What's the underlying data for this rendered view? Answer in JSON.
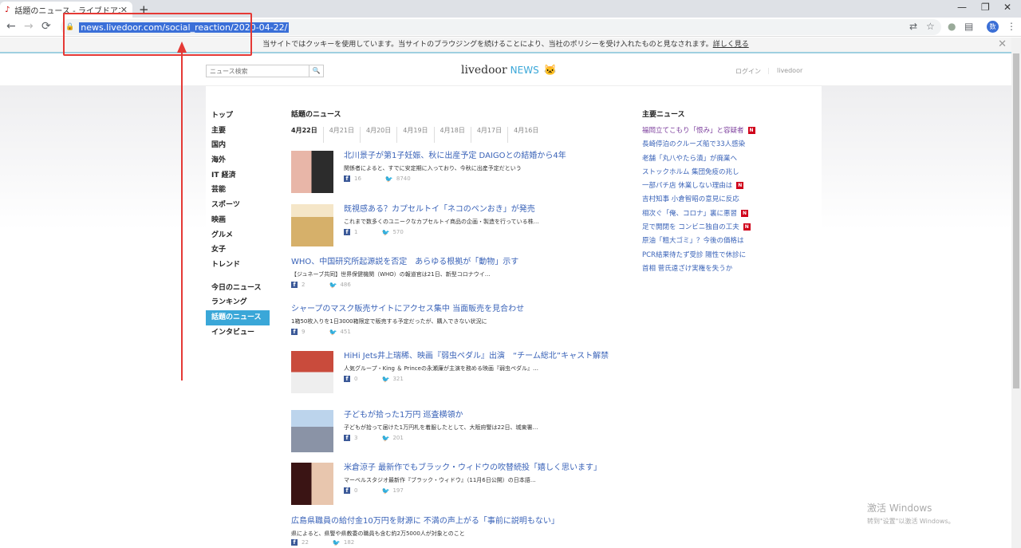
{
  "browser": {
    "tab_title": "話題のニュース - ライブドアニ",
    "tab_favicon": "♪",
    "tab_close": "✕",
    "new_tab": "+",
    "win_minimize": "—",
    "win_restore": "❐",
    "win_close": "✕",
    "back": "←",
    "forward": "→",
    "reload": "⟳",
    "url": "news.livedoor.com/social_reaction/2020-04-22/",
    "profile_initial": "数",
    "menu": "⋮"
  },
  "cookie_bar": {
    "text": "当サイトではクッキーを使用しています。当サイトのブラウジングを続けることにより、当社のポリシーを受け入れたものと見なされます。",
    "link": "詳しく見る",
    "close": "✕"
  },
  "header": {
    "search_placeholder": "ニュース検索",
    "search_btn_icon": "search-icon",
    "logo_main": "livedoor",
    "logo_news": "NEWS",
    "login": "ログイン",
    "divider": "|",
    "livedoor_link": "livedoor"
  },
  "sidebar": {
    "group1": [
      "トップ",
      "主要",
      "国内",
      "海外",
      "IT 経済",
      "芸能",
      "スポーツ",
      "映画",
      "グルメ",
      "女子",
      "トレンド"
    ],
    "group2": [
      "今日のニュース",
      "ランキング",
      "話題のニュース",
      "インタビュー"
    ],
    "active": "話題のニュース"
  },
  "main": {
    "section_title": "話題のニュース",
    "date_tabs": [
      "4月22日",
      "4月21日",
      "4月20日",
      "4月19日",
      "4月18日",
      "4月17日",
      "4月16日"
    ],
    "articles": [
      {
        "title": "北川景子が第1子妊娠、秋に出産予定 DAIGOとの結婚から4年",
        "desc": "関係者によると、すでに安定期に入っており、今秋に出産予定だという",
        "fb": "16",
        "tw": "8740"
      },
      {
        "title": "既視感ある？カプセルトイ「ネコのペンおき」が発売",
        "desc": "これまで数多くのユニークなカプセルトイ商品の企画・製造を行っている株…",
        "fb": "1",
        "tw": "570"
      },
      {
        "title": "WHO、中国研究所起源説を否定　あらゆる根拠が「動物」示す",
        "desc": "【ジュネーブ共同】世界保健機関（WHO）の報道官は21日、新型コロナウイ…",
        "fb": "2",
        "tw": "486"
      },
      {
        "title": "シャープのマスク販売サイトにアクセス集中 当面販売を見合わせ",
        "desc": "1箱50枚入りを1日3000箱限定で販売する予定だったが、購入できない状況に",
        "fb": "9",
        "tw": "451"
      },
      {
        "title": "HiHi Jets井上瑞稀、映画『弱虫ペダル』出演　“チーム総北”キャスト解禁",
        "desc": "人気グループ・King ＆ Princeの永瀬廉が主演を務める映画『弱虫ペダル』…",
        "fb": "0",
        "tw": "321"
      },
      {
        "title": "子どもが拾った1万円 巡査横領か",
        "desc": "子どもが拾って届けた1万円札を着服したとして、大阪府警は22日、城東署…",
        "fb": "3",
        "tw": "201"
      },
      {
        "title": "米倉涼子 最新作でもブラック・ウィドウの吹替続投「嬉しく思います」",
        "desc": "マーベルスタジオ最新作『ブラック・ウィドウ』（11月6日公開）の日本語…",
        "fb": "0",
        "tw": "197"
      },
      {
        "title": "広島県職員の給付金10万円を財源に 不満の声上がる「事前に説明もない」",
        "desc": "県によると、県警や県教委の職員も含む約2万5000人が対象とのこと",
        "fb": "22",
        "tw": "182"
      }
    ]
  },
  "right": {
    "title": "主要ニュース",
    "items": [
      {
        "text": "福岡立てこもり「恨み」と容疑者",
        "n": true
      },
      {
        "text": "長崎停泊のクルーズ船で33人感染",
        "n": false
      },
      {
        "text": "老舗「丸八やたら漬」が廃業へ",
        "n": false
      },
      {
        "text": "ストックホルム 集団免疫の兆し",
        "n": false
      },
      {
        "text": "一部パチ店 休業しない理由は",
        "n": true
      },
      {
        "text": "吉村知事 小倉智昭の意見に反応",
        "n": false
      },
      {
        "text": "相次ぐ「俺、コロナ」裏に悪習",
        "n": true
      },
      {
        "text": "足で開閉を コンビニ独自の工夫",
        "n": true
      },
      {
        "text": "原油「粗大ゴミ」？今後の価格は",
        "n": false
      },
      {
        "text": "PCR結果待たず受診 陽性で休診に",
        "n": false
      },
      {
        "text": "首相 菅氏遠ざけ実権を失うか",
        "n": false
      }
    ],
    "badge": "N"
  },
  "watermark": {
    "line1": "激活 Windows",
    "line2": "转到\"设置\"以激活 Windows。"
  },
  "colors": {
    "accent": "#3aa7d8",
    "link": "#3a63b8",
    "annotation": "#e53935"
  }
}
